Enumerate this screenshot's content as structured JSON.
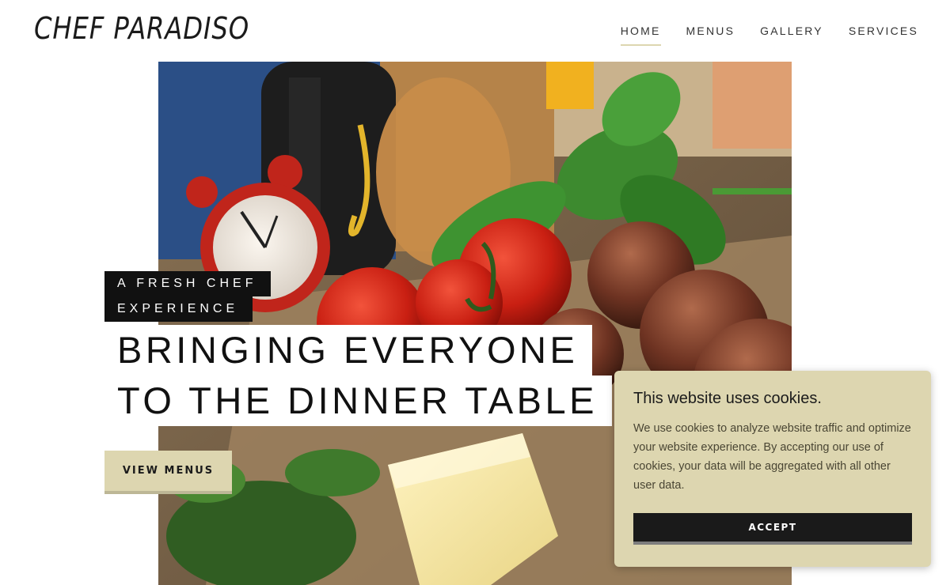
{
  "header": {
    "logo": "CHEF PARADISO",
    "nav": [
      {
        "label": "HOME",
        "active": true
      },
      {
        "label": "MENUS",
        "active": false
      },
      {
        "label": "GALLERY",
        "active": false
      },
      {
        "label": "SERVICES",
        "active": false
      }
    ]
  },
  "hero": {
    "tagline_lines": [
      "A FRESH CHEF",
      "EXPERIENCE"
    ],
    "headline_lines": [
      "BRINGING EVERYONE",
      "TO THE DINNER TABLE"
    ],
    "cta_label": "VIEW MENUS"
  },
  "cookie_banner": {
    "title": "This website uses cookies.",
    "text": "We use cookies to analyze website traffic and optimize your website experience. By accepting our use of cookies, your data will be aggregated with all other user data.",
    "accept_label": "ACCEPT"
  },
  "colors": {
    "accent": "#ddd6b0",
    "dark": "#111111",
    "text": "#1b1b1b"
  }
}
